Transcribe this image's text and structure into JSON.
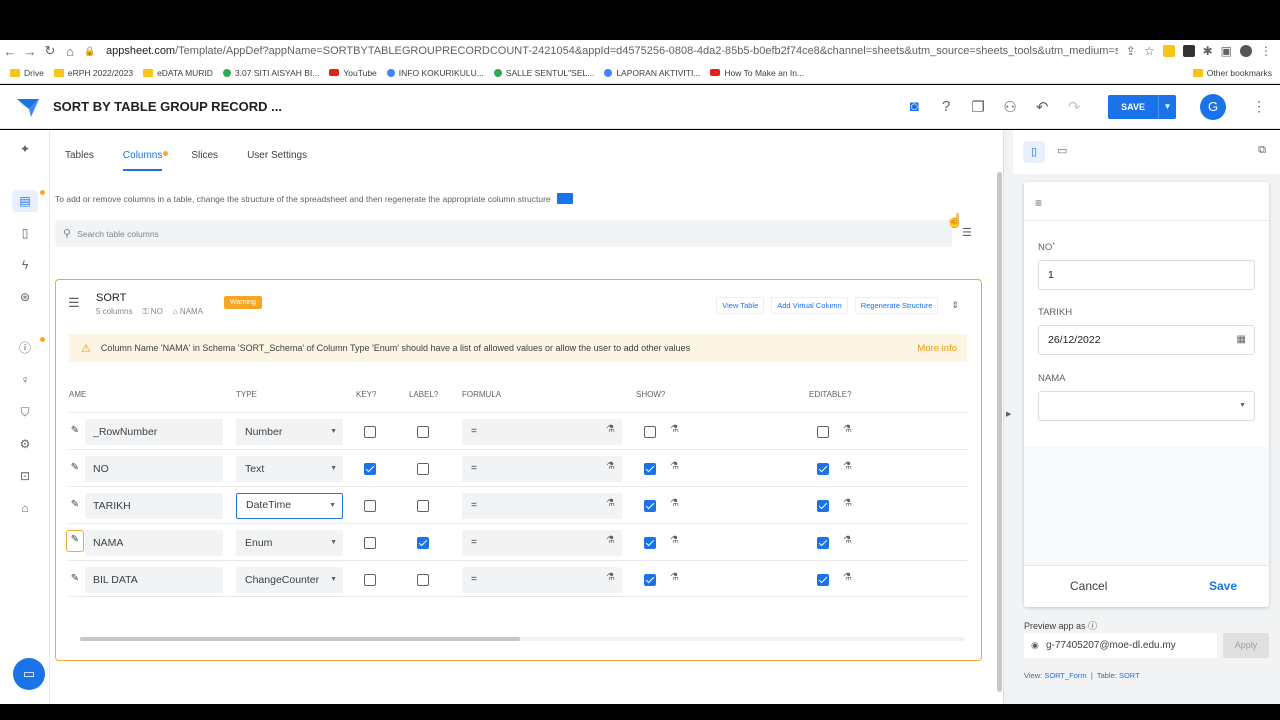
{
  "browser": {
    "url_host": "appsheet.com",
    "url_rest": "/Template/AppDef?appName=SORTBYTABLEGROUPRECORDCOUNT-2421054&appId=d4575256-0808-4da2-85b5-b0efb2f74ce8&channel=sheets&utm_source=sheets_tools&utm_medium=sheets&utm_campaign=workspa...",
    "bookmarks": [
      "Drive",
      "eRPH 2022/2023",
      "eDATA MURID",
      "3.07 SITI AISYAH BI...",
      "YouTube",
      "INFO KOKURIKULU...",
      "SALLE SENTUL\"SEL...",
      "LAPORAN AKTIVITI...",
      "How To Make an In..."
    ],
    "other_bookmarks": "Other bookmarks"
  },
  "header": {
    "title": "SORT BY TABLE GROUP RECORD ...",
    "save_label": "SAVE",
    "avatar_letter": "G"
  },
  "tabs": [
    "Tables",
    "Columns",
    "Slices",
    "User Settings"
  ],
  "active_tab": "Columns",
  "info_text": "To add or remove columns in a table, change the structure of the spreadsheet and then regenerate the appropriate column structure",
  "search_placeholder": "Search table columns",
  "table_card": {
    "name": "SORT",
    "columns_count": "5 columns",
    "key_tag": "NO",
    "label_tag": "NAMA",
    "badge": "Warning",
    "actions": [
      "View Table",
      "Add Virtual Column",
      "Regenerate Structure"
    ],
    "warning_text": "Column Name 'NAMA' in Schema 'SORT_Schema' of Column Type 'Enum' should have a list of allowed values or allow the user to add other values",
    "more_info": "More info",
    "headers": {
      "name": "AME",
      "type": "TYPE",
      "key": "KEY?",
      "label": "LABEL?",
      "formula": "FORMULA",
      "show": "SHOW?",
      "editable": "EDITABLE?"
    },
    "rows": [
      {
        "name": "_RowNumber",
        "type": "Number",
        "key": false,
        "label": false,
        "formula": "=",
        "show": false,
        "editable": false
      },
      {
        "name": "NO",
        "type": "Text",
        "key": true,
        "label": false,
        "formula": "=",
        "show": true,
        "editable": true
      },
      {
        "name": "TARIKH",
        "type": "DateTime",
        "key": false,
        "label": false,
        "formula": "=",
        "show": true,
        "editable": true
      },
      {
        "name": "NAMA",
        "type": "Enum",
        "key": false,
        "label": true,
        "formula": "=",
        "show": true,
        "editable": true
      },
      {
        "name": "BIL DATA",
        "type": "ChangeCounter",
        "key": false,
        "label": false,
        "formula": "=",
        "show": true,
        "editable": true
      }
    ]
  },
  "preview": {
    "fields": [
      {
        "label": "NO",
        "required": "*",
        "value": "1"
      },
      {
        "label": "TARIKH",
        "value": "26/12/2022"
      },
      {
        "label": "NAMA",
        "value": ""
      }
    ],
    "cancel": "Cancel",
    "save": "Save",
    "preview_as_label": "Preview app as",
    "preview_user": "g-77405207@moe-dl.edu.my",
    "apply": "Apply",
    "view_label": "View:",
    "view_name": "SORT_Form",
    "table_label": "Table:",
    "table_name": "SORT"
  },
  "colors": {
    "accent": "#1a73e8",
    "warning": "#f5a623",
    "card_border": "#f4a836"
  }
}
